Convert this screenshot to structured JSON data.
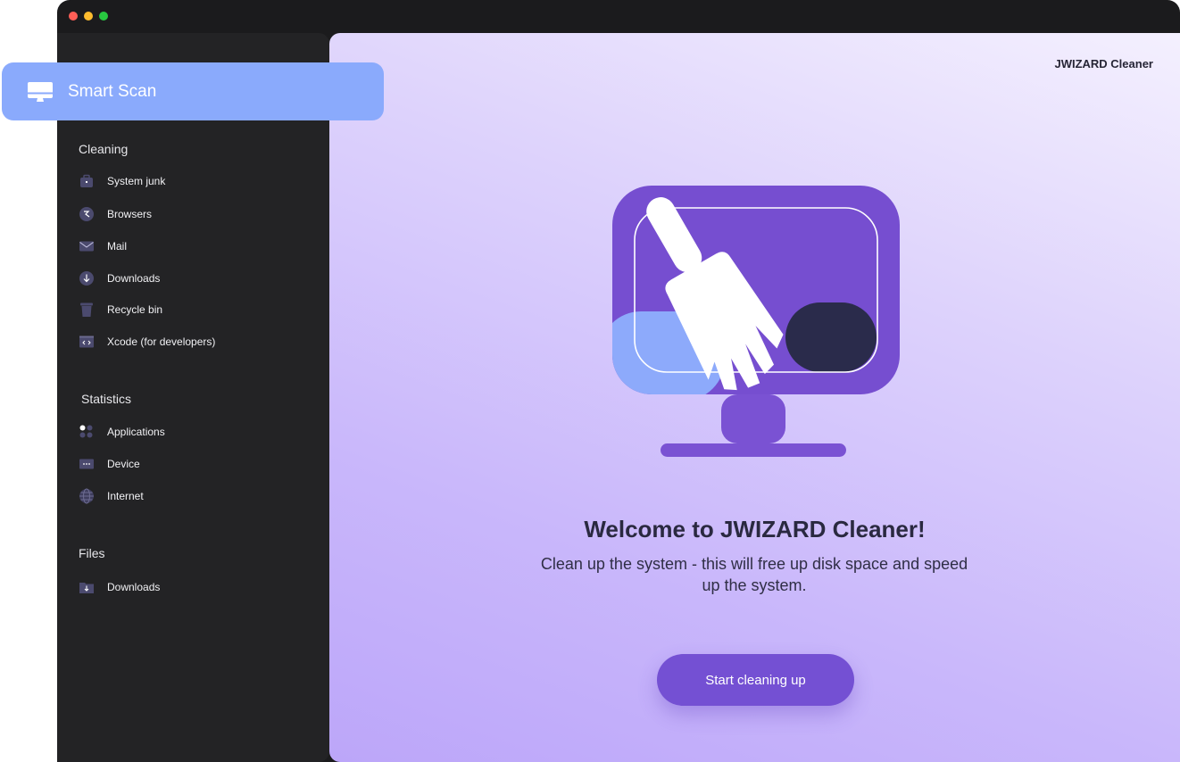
{
  "brand": "JWIZARD Cleaner",
  "smart_scan": {
    "label": "Smart Scan",
    "icon": "monitor-icon"
  },
  "sidebar": {
    "sections": [
      {
        "title": "Cleaning",
        "items": [
          {
            "label": "System junk",
            "icon": "briefcase-icon"
          },
          {
            "label": "Browsers",
            "icon": "browser-icon"
          },
          {
            "label": "Mail",
            "icon": "mail-icon"
          },
          {
            "label": "Downloads",
            "icon": "download-icon"
          },
          {
            "label": "Recycle bin",
            "icon": "trash-icon"
          },
          {
            "label": "Xcode (for developers)",
            "icon": "code-icon"
          }
        ]
      },
      {
        "title": "Statistics",
        "items": [
          {
            "label": "Applications",
            "icon": "apps-icon"
          },
          {
            "label": "Device",
            "icon": "device-icon"
          },
          {
            "label": "Internet",
            "icon": "globe-icon"
          }
        ]
      },
      {
        "title": "Files",
        "items": [
          {
            "label": "Downloads",
            "icon": "folder-download-icon"
          }
        ]
      }
    ]
  },
  "main": {
    "headline": "Welcome to JWIZARD Cleaner!",
    "subline": "Clean up the system - this will free up disk space and speed up the system.",
    "cta_label": "Start cleaning up"
  },
  "colors": {
    "accent": "#7450d3",
    "smart_scan_bg": "#8aaafc",
    "sidebar_bg": "#232325",
    "window_bg": "#1b1b1d"
  }
}
